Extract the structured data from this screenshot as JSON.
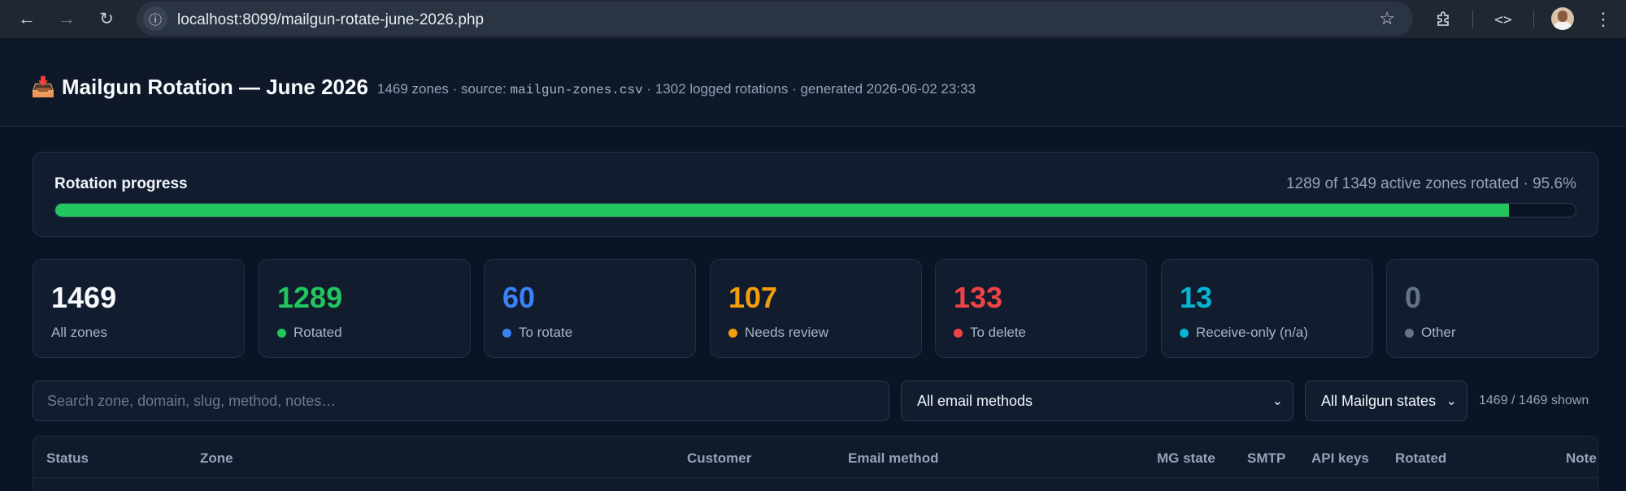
{
  "browser": {
    "url": "localhost:8099/mailgun-rotate-june-2026.php",
    "icons": [
      "back-arrow-icon",
      "forward-arrow-icon",
      "reload-icon",
      "site-info-icon",
      "bookmark-star-icon",
      "extensions-icon",
      "devtools-icon",
      "profile-avatar",
      "kebab-menu-icon"
    ]
  },
  "header": {
    "title": "Mailgun Rotation — June 2026",
    "title_icon": "inbox-tray-icon",
    "summary_prefix": "1469 zones · source: ",
    "source_file": "mailgun-zones.csv",
    "summary_suffix": " · 1302 logged rotations · generated 2026-06-02 23:33"
  },
  "progress": {
    "title": "Rotation progress",
    "stats": "1289 of 1349 active zones rotated · 95.6%",
    "fraction": 0.956,
    "color": "#22c55e"
  },
  "cards": [
    {
      "value": "1469",
      "label": "All zones",
      "color": "#f8fafc",
      "dot": ""
    },
    {
      "value": "1289",
      "label": "Rotated",
      "color": "#22c55e",
      "dot": "#22c55e"
    },
    {
      "value": "60",
      "label": "To rotate",
      "color": "#3b82f6",
      "dot": "#3b82f6"
    },
    {
      "value": "107",
      "label": "Needs review",
      "color": "#f59e0b",
      "dot": "#f59e0b"
    },
    {
      "value": "133",
      "label": "To delete",
      "color": "#ef4444",
      "dot": "#ef4444"
    },
    {
      "value": "13",
      "label": "Receive-only (n/a)",
      "color": "#06b6d4",
      "dot": "#06b6d4"
    },
    {
      "value": "0",
      "label": "Other",
      "color": "#64748b",
      "dot": "#64748b"
    }
  ],
  "filters": {
    "search_placeholder": "Search zone, domain, slug, method, notes…",
    "method_select": "All email methods",
    "state_select": "All Mailgun states",
    "shown": "1469 / 1469 shown"
  },
  "table": {
    "columns": [
      "Status",
      "Zone",
      "Customer",
      "Email method",
      "MG state",
      "SMTP",
      "API keys",
      "Rotated",
      "Note"
    ]
  }
}
